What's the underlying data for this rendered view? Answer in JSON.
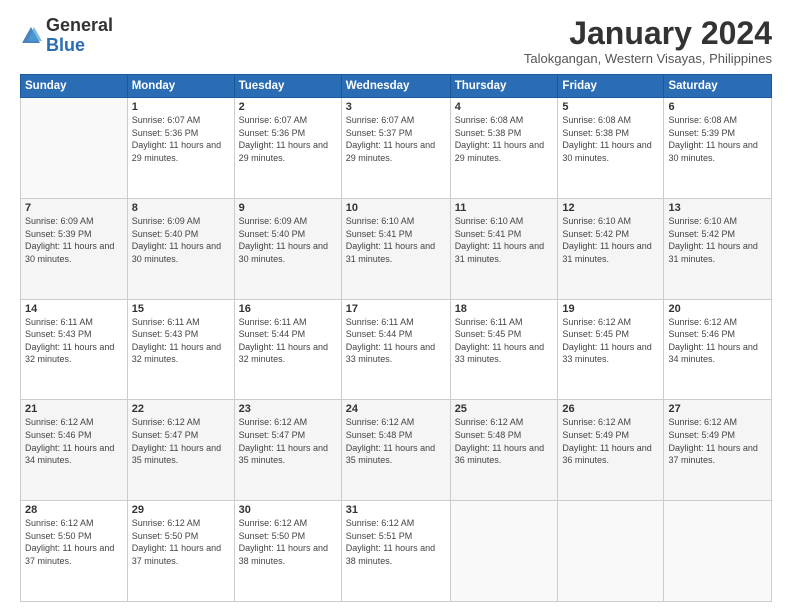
{
  "logo": {
    "general": "General",
    "blue": "Blue"
  },
  "header": {
    "title": "January 2024",
    "subtitle": "Talokgangan, Western Visayas, Philippines"
  },
  "weekdays": [
    "Sunday",
    "Monday",
    "Tuesday",
    "Wednesday",
    "Thursday",
    "Friday",
    "Saturday"
  ],
  "weeks": [
    [
      {
        "day": "",
        "sunrise": "",
        "sunset": "",
        "daylight": ""
      },
      {
        "day": "1",
        "sunrise": "Sunrise: 6:07 AM",
        "sunset": "Sunset: 5:36 PM",
        "daylight": "Daylight: 11 hours and 29 minutes."
      },
      {
        "day": "2",
        "sunrise": "Sunrise: 6:07 AM",
        "sunset": "Sunset: 5:36 PM",
        "daylight": "Daylight: 11 hours and 29 minutes."
      },
      {
        "day": "3",
        "sunrise": "Sunrise: 6:07 AM",
        "sunset": "Sunset: 5:37 PM",
        "daylight": "Daylight: 11 hours and 29 minutes."
      },
      {
        "day": "4",
        "sunrise": "Sunrise: 6:08 AM",
        "sunset": "Sunset: 5:38 PM",
        "daylight": "Daylight: 11 hours and 29 minutes."
      },
      {
        "day": "5",
        "sunrise": "Sunrise: 6:08 AM",
        "sunset": "Sunset: 5:38 PM",
        "daylight": "Daylight: 11 hours and 30 minutes."
      },
      {
        "day": "6",
        "sunrise": "Sunrise: 6:08 AM",
        "sunset": "Sunset: 5:39 PM",
        "daylight": "Daylight: 11 hours and 30 minutes."
      }
    ],
    [
      {
        "day": "7",
        "sunrise": "Sunrise: 6:09 AM",
        "sunset": "Sunset: 5:39 PM",
        "daylight": "Daylight: 11 hours and 30 minutes."
      },
      {
        "day": "8",
        "sunrise": "Sunrise: 6:09 AM",
        "sunset": "Sunset: 5:40 PM",
        "daylight": "Daylight: 11 hours and 30 minutes."
      },
      {
        "day": "9",
        "sunrise": "Sunrise: 6:09 AM",
        "sunset": "Sunset: 5:40 PM",
        "daylight": "Daylight: 11 hours and 30 minutes."
      },
      {
        "day": "10",
        "sunrise": "Sunrise: 6:10 AM",
        "sunset": "Sunset: 5:41 PM",
        "daylight": "Daylight: 11 hours and 31 minutes."
      },
      {
        "day": "11",
        "sunrise": "Sunrise: 6:10 AM",
        "sunset": "Sunset: 5:41 PM",
        "daylight": "Daylight: 11 hours and 31 minutes."
      },
      {
        "day": "12",
        "sunrise": "Sunrise: 6:10 AM",
        "sunset": "Sunset: 5:42 PM",
        "daylight": "Daylight: 11 hours and 31 minutes."
      },
      {
        "day": "13",
        "sunrise": "Sunrise: 6:10 AM",
        "sunset": "Sunset: 5:42 PM",
        "daylight": "Daylight: 11 hours and 31 minutes."
      }
    ],
    [
      {
        "day": "14",
        "sunrise": "Sunrise: 6:11 AM",
        "sunset": "Sunset: 5:43 PM",
        "daylight": "Daylight: 11 hours and 32 minutes."
      },
      {
        "day": "15",
        "sunrise": "Sunrise: 6:11 AM",
        "sunset": "Sunset: 5:43 PM",
        "daylight": "Daylight: 11 hours and 32 minutes."
      },
      {
        "day": "16",
        "sunrise": "Sunrise: 6:11 AM",
        "sunset": "Sunset: 5:44 PM",
        "daylight": "Daylight: 11 hours and 32 minutes."
      },
      {
        "day": "17",
        "sunrise": "Sunrise: 6:11 AM",
        "sunset": "Sunset: 5:44 PM",
        "daylight": "Daylight: 11 hours and 33 minutes."
      },
      {
        "day": "18",
        "sunrise": "Sunrise: 6:11 AM",
        "sunset": "Sunset: 5:45 PM",
        "daylight": "Daylight: 11 hours and 33 minutes."
      },
      {
        "day": "19",
        "sunrise": "Sunrise: 6:12 AM",
        "sunset": "Sunset: 5:45 PM",
        "daylight": "Daylight: 11 hours and 33 minutes."
      },
      {
        "day": "20",
        "sunrise": "Sunrise: 6:12 AM",
        "sunset": "Sunset: 5:46 PM",
        "daylight": "Daylight: 11 hours and 34 minutes."
      }
    ],
    [
      {
        "day": "21",
        "sunrise": "Sunrise: 6:12 AM",
        "sunset": "Sunset: 5:46 PM",
        "daylight": "Daylight: 11 hours and 34 minutes."
      },
      {
        "day": "22",
        "sunrise": "Sunrise: 6:12 AM",
        "sunset": "Sunset: 5:47 PM",
        "daylight": "Daylight: 11 hours and 35 minutes."
      },
      {
        "day": "23",
        "sunrise": "Sunrise: 6:12 AM",
        "sunset": "Sunset: 5:47 PM",
        "daylight": "Daylight: 11 hours and 35 minutes."
      },
      {
        "day": "24",
        "sunrise": "Sunrise: 6:12 AM",
        "sunset": "Sunset: 5:48 PM",
        "daylight": "Daylight: 11 hours and 35 minutes."
      },
      {
        "day": "25",
        "sunrise": "Sunrise: 6:12 AM",
        "sunset": "Sunset: 5:48 PM",
        "daylight": "Daylight: 11 hours and 36 minutes."
      },
      {
        "day": "26",
        "sunrise": "Sunrise: 6:12 AM",
        "sunset": "Sunset: 5:49 PM",
        "daylight": "Daylight: 11 hours and 36 minutes."
      },
      {
        "day": "27",
        "sunrise": "Sunrise: 6:12 AM",
        "sunset": "Sunset: 5:49 PM",
        "daylight": "Daylight: 11 hours and 37 minutes."
      }
    ],
    [
      {
        "day": "28",
        "sunrise": "Sunrise: 6:12 AM",
        "sunset": "Sunset: 5:50 PM",
        "daylight": "Daylight: 11 hours and 37 minutes."
      },
      {
        "day": "29",
        "sunrise": "Sunrise: 6:12 AM",
        "sunset": "Sunset: 5:50 PM",
        "daylight": "Daylight: 11 hours and 37 minutes."
      },
      {
        "day": "30",
        "sunrise": "Sunrise: 6:12 AM",
        "sunset": "Sunset: 5:50 PM",
        "daylight": "Daylight: 11 hours and 38 minutes."
      },
      {
        "day": "31",
        "sunrise": "Sunrise: 6:12 AM",
        "sunset": "Sunset: 5:51 PM",
        "daylight": "Daylight: 11 hours and 38 minutes."
      },
      {
        "day": "",
        "sunrise": "",
        "sunset": "",
        "daylight": ""
      },
      {
        "day": "",
        "sunrise": "",
        "sunset": "",
        "daylight": ""
      },
      {
        "day": "",
        "sunrise": "",
        "sunset": "",
        "daylight": ""
      }
    ]
  ]
}
